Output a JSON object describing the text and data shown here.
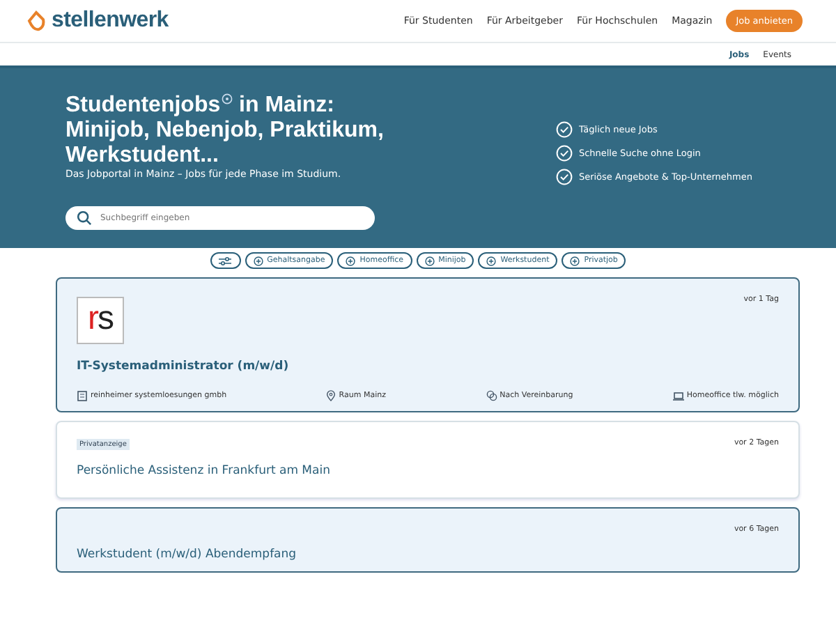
{
  "header": {
    "logo": "stellenwerk",
    "nav": [
      "Für Studenten",
      "Für Arbeitgeber",
      "Für Hochschulen",
      "Magazin"
    ],
    "cta": "Job anbieten"
  },
  "subnav": [
    {
      "label": "Jobs",
      "selected": true
    },
    {
      "label": "Events",
      "selected": false
    }
  ],
  "hero": {
    "title_start": "Studentenjobs",
    "title_rest": "in Mainz: Minijob, Nebenjob, Praktikum, Werkstudent...",
    "subtitle": "Das Jobportal in Mainz – Jobs für jede Phase im Studium.",
    "search": {
      "placeholder": "Suchbegriff eingeben"
    },
    "features": [
      "Täglich neue Jobs",
      "Schnelle Suche ohne Login",
      "Seriöse Angebote & Top-Unternehmen"
    ]
  },
  "filters": [
    "Gehaltsangabe",
    "Homeoffice",
    "Minijob",
    "Werkstudent",
    "Privatjob"
  ],
  "jobs": [
    {
      "kind": "featured",
      "logo": "rs",
      "age": "vor 1 Tag",
      "title": "IT-Systemadministrator (m/w/d)",
      "company": "reinheimer systemloesungen gmbh",
      "location": "Raum Mainz",
      "salary": "Nach Vereinbarung",
      "remote": "Homeoffice tlw. möglich"
    },
    {
      "kind": "plain",
      "tag": "Privatanzeige",
      "age": "vor 2 Tagen",
      "title": "Persönliche Assistenz in Frankfurt am Main"
    },
    {
      "kind": "featured",
      "age": "vor 6 Tagen",
      "title": "Werkstudent (m/w/d) Abendempfang"
    }
  ]
}
